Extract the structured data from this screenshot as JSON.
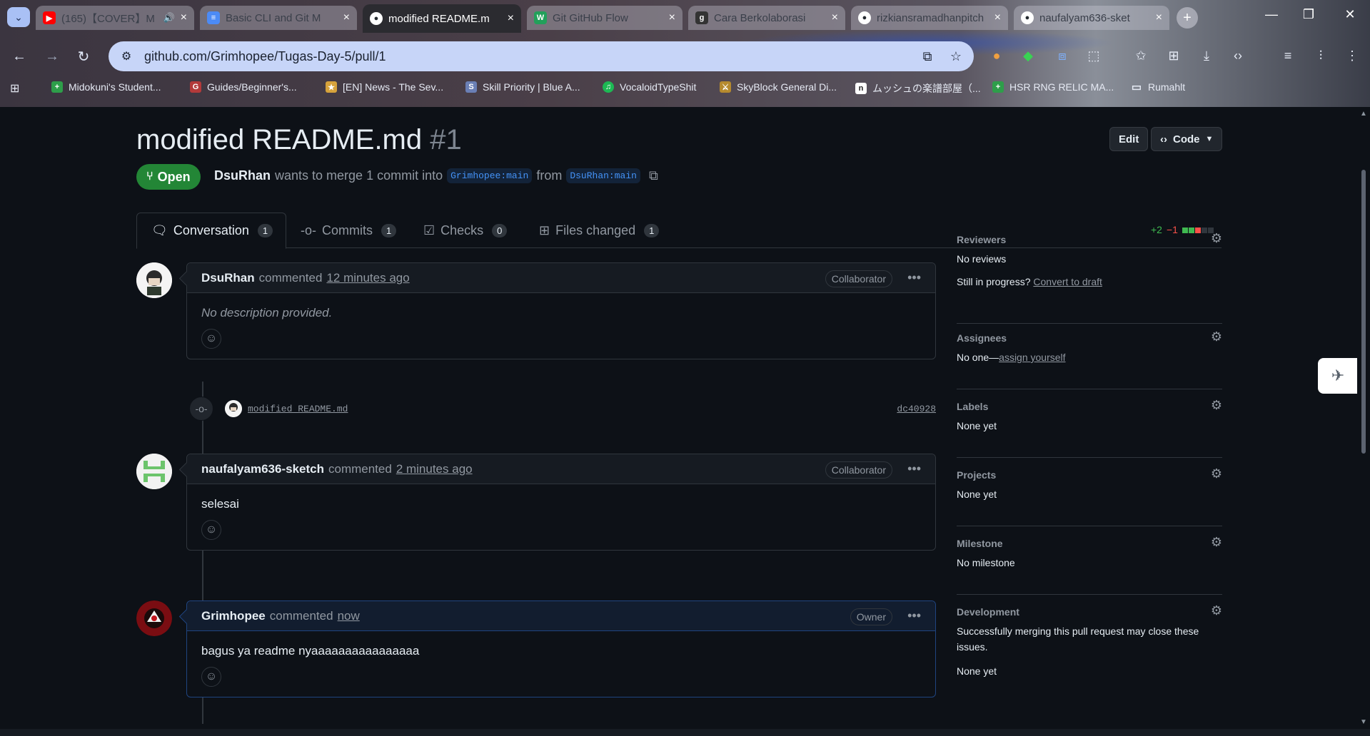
{
  "browser": {
    "tabs": [
      {
        "title": "(165)【COVER】M",
        "icon": "youtube-icon",
        "color": "#ff0000",
        "glyph": "▶"
      },
      {
        "title": "Basic CLI and Git M",
        "icon": "doc-icon",
        "color": "#4c8bf5",
        "glyph": "≡"
      },
      {
        "title": "modified README.m",
        "icon": "github-icon",
        "color": "#24292f",
        "glyph": "●"
      },
      {
        "title": "Git GitHub Flow",
        "icon": "w-icon",
        "color": "#22a05a",
        "glyph": "W"
      },
      {
        "title": "Cara Berkolaborasi",
        "icon": "g-icon",
        "color": "#333333",
        "glyph": "g"
      },
      {
        "title": "rizkiansramadhanpitch",
        "icon": "github-icon",
        "color": "#24292f",
        "glyph": "●"
      },
      {
        "title": "naufalyam636-sket",
        "icon": "github-icon",
        "color": "#24292f",
        "glyph": "●"
      }
    ],
    "url": "github.com/Grimhopee/Tugas-Day-5/pull/1",
    "bookmarks": [
      {
        "label": "Midokuni's Student...",
        "color": "#2e9e4a",
        "glyph": "+"
      },
      {
        "label": "Guides/Beginner's...",
        "color": "#b33a3a",
        "glyph": "G"
      },
      {
        "label": "[EN] News - The Sev...",
        "color": "#d6a23b",
        "glyph": "★"
      },
      {
        "label": "Skill Priority | Blue A...",
        "color": "#6a7fb5",
        "glyph": "S"
      },
      {
        "label": "VocaloidTypeShit",
        "color": "#1db954",
        "glyph": "♫"
      },
      {
        "label": "SkyBlock General Di...",
        "color": "#b58a2e",
        "glyph": "⚔"
      },
      {
        "label": "ムッシュの楽譜部屋（...",
        "color": "#222222",
        "glyph": "n"
      },
      {
        "label": "HSR RNG RELIC MA...",
        "color": "#2e9e4a",
        "glyph": "+"
      },
      {
        "label": "Rumahlt",
        "color": "#e6eaf4",
        "glyph": "▭"
      }
    ]
  },
  "pr": {
    "title": "modified README.md",
    "number": "#1",
    "edit_label": "Edit",
    "code_label": "Code",
    "state": "Open",
    "author": "DsuRhan",
    "meta_text": "wants to merge 1 commit into",
    "base_branch": "Grimhopee:main",
    "from_text": "from",
    "head_branch": "DsuRhan:main",
    "tabs": [
      {
        "label": "Conversation",
        "count": "1"
      },
      {
        "label": "Commits",
        "count": "1"
      },
      {
        "label": "Checks",
        "count": "0"
      },
      {
        "label": "Files changed",
        "count": "1"
      }
    ],
    "diff_add": "+2",
    "diff_del": "−1"
  },
  "timeline": {
    "comments": [
      {
        "author": "DsuRhan",
        "action": "commented",
        "time": "12 minutes ago",
        "role": "Collaborator",
        "body": "No description provided."
      },
      {
        "author": "naufalyam636-sketch",
        "action": "commented",
        "time": "2 minutes ago",
        "role": "Collaborator",
        "body": "selesai"
      },
      {
        "author": "Grimhopee",
        "action": "commented",
        "time": "now",
        "role": "Owner",
        "body": "bagus ya readme nyaaaaaaaaaaaaaaaa"
      }
    ],
    "commit": {
      "message": "modified README.md",
      "sha": "dc40928"
    }
  },
  "sidebar": {
    "reviewers": {
      "heading": "Reviewers",
      "value": "No reviews",
      "prompt": "Still in progress?",
      "link": "Convert to draft"
    },
    "assignees": {
      "heading": "Assignees",
      "value": "No one—",
      "link": "assign yourself"
    },
    "labels": {
      "heading": "Labels",
      "value": "None yet"
    },
    "projects": {
      "heading": "Projects",
      "value": "None yet"
    },
    "milestone": {
      "heading": "Milestone",
      "value": "No milestone"
    },
    "development": {
      "heading": "Development",
      "value": "Successfully merging this pull request may close these issues.",
      "value2": "None yet"
    }
  },
  "colors": {
    "open_green": "#238636",
    "link_blue": "#4493f8",
    "page_bg": "#0d1117"
  }
}
